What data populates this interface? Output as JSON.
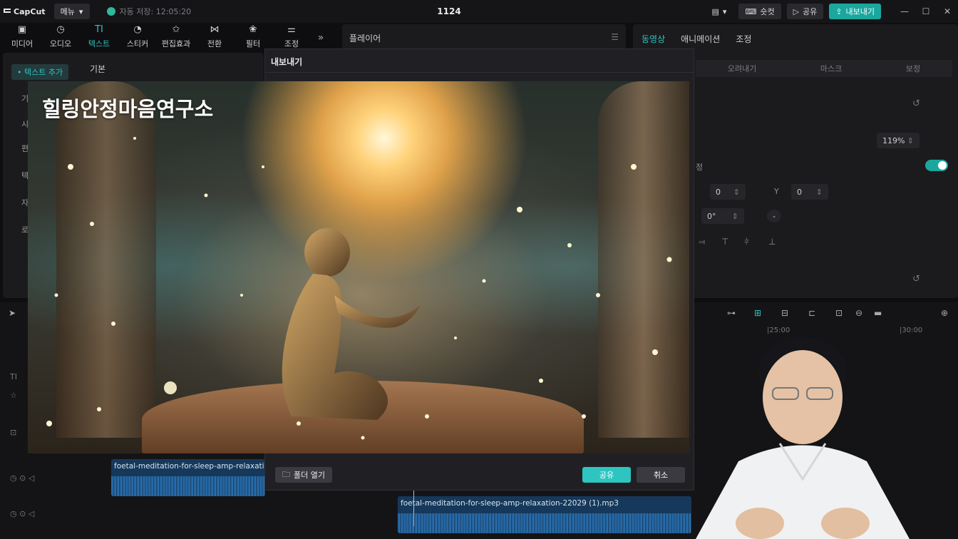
{
  "app": {
    "logo_text": "CapCut",
    "menu_label": "메뉴",
    "autosave_text": "자동 저장: 12:05:20",
    "project_title": "1124"
  },
  "titlebar": {
    "shortcut_label": "숏컷",
    "share_label": "공유",
    "export_label": "내보내기"
  },
  "tools": [
    {
      "label": "미디어",
      "icon": "media-icon"
    },
    {
      "label": "오디오",
      "icon": "audio-icon"
    },
    {
      "label": "텍스트",
      "icon": "text-icon"
    },
    {
      "label": "스티커",
      "icon": "sticker-icon"
    },
    {
      "label": "편집효과",
      "icon": "effects-icon"
    },
    {
      "label": "전환",
      "icon": "transition-icon"
    },
    {
      "label": "필터",
      "icon": "filter-icon"
    },
    {
      "label": "조정",
      "icon": "adjust-icon"
    }
  ],
  "left_panel": {
    "add_text_label": "• 텍스트 추가",
    "basic_label": "기본",
    "side_items": [
      "기",
      "시",
      "편",
      "텍",
      "자",
      "로"
    ]
  },
  "player": {
    "title": "플레이어"
  },
  "right_panel": {
    "tabs": [
      "동영상",
      "애니메이션",
      "조정"
    ],
    "active_tab": "동영상",
    "subtabs": [
      "오려내기",
      "마스크",
      "보정"
    ],
    "scale_value": "119%",
    "position_label": "정",
    "x_value": "0",
    "y_label": "Y",
    "y_value": "0",
    "rotation_value": "0°",
    "rotation_extra": "-"
  },
  "timeline": {
    "ruler": [
      "|25:00",
      "|30:00"
    ],
    "clip_1_name": "foetal-meditation-for-sleep-amp-relaxation",
    "clip_2_name": "foetal-meditation-for-sleep-amp-relaxation-22029 (1).mp3",
    "side_icons": [
      "TI",
      "☆"
    ]
  },
  "dialog": {
    "title": "내보내기",
    "open_folder_label": "폴더 열기",
    "share_label": "공유",
    "cancel_label": "취소"
  },
  "preview": {
    "overlay_text": "힐링안정마음연구소"
  },
  "colors": {
    "accent": "#2ec5c0",
    "export_button": "#1aa79e",
    "background": "#0e0e10",
    "panel": "#1b1b1e"
  }
}
